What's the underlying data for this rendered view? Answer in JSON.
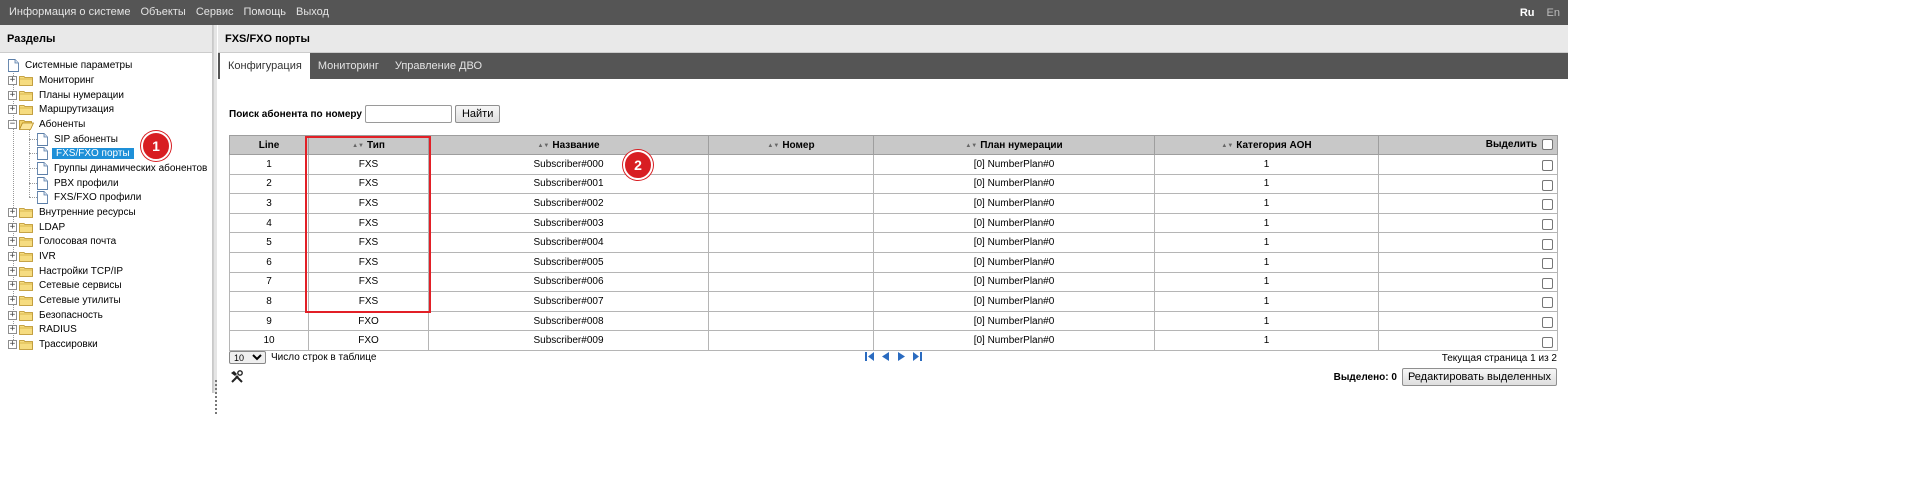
{
  "topbar": {
    "menu": [
      "Информация о системе",
      "Объекты",
      "Сервис",
      "Помощь",
      "Выход"
    ],
    "languages": [
      "Ru",
      "En"
    ],
    "active_language": "Ru"
  },
  "sidebar": {
    "title": "Разделы",
    "items": [
      {
        "label": "Системные параметры"
      },
      {
        "label": "Мониторинг"
      },
      {
        "label": "Планы нумерации"
      },
      {
        "label": "Маршрутизация"
      },
      {
        "label": "Абоненты"
      },
      {
        "label": "SIP абоненты"
      },
      {
        "label": "FXS/FXO порты"
      },
      {
        "label": "Группы динамических абонентов"
      },
      {
        "label": "PBX профили"
      },
      {
        "label": "FXS/FXO профили"
      },
      {
        "label": "Внутренние ресурсы"
      },
      {
        "label": "LDAP"
      },
      {
        "label": "Голосовая почта"
      },
      {
        "label": "IVR"
      },
      {
        "label": "Настройки TCP/IP"
      },
      {
        "label": "Сетевые сервисы"
      },
      {
        "label": "Сетевые утилиты"
      },
      {
        "label": "Безопасность"
      },
      {
        "label": "RADIUS"
      },
      {
        "label": "Трассировки"
      }
    ],
    "selected": "FXS/FXO порты"
  },
  "main": {
    "title": "FXS/FXO порты",
    "tabs": [
      "Конфигурация",
      "Мониторинг",
      "Управление ДВО"
    ],
    "active_tab": "Конфигурация",
    "search": {
      "label": "Поиск абонента по номеру",
      "value": "",
      "button": "Найти"
    },
    "table": {
      "columns": [
        "Line",
        "Тип",
        "Название",
        "Номер",
        "План нумерации",
        "Категория АОН",
        "Выделить"
      ],
      "rows": [
        {
          "line": "1",
          "type": "FXS",
          "name": "Subscriber#000",
          "number": "",
          "plan": "[0] NumberPlan#0",
          "category": "1"
        },
        {
          "line": "2",
          "type": "FXS",
          "name": "Subscriber#001",
          "number": "",
          "plan": "[0] NumberPlan#0",
          "category": "1"
        },
        {
          "line": "3",
          "type": "FXS",
          "name": "Subscriber#002",
          "number": "",
          "plan": "[0] NumberPlan#0",
          "category": "1"
        },
        {
          "line": "4",
          "type": "FXS",
          "name": "Subscriber#003",
          "number": "",
          "plan": "[0] NumberPlan#0",
          "category": "1"
        },
        {
          "line": "5",
          "type": "FXS",
          "name": "Subscriber#004",
          "number": "",
          "plan": "[0] NumberPlan#0",
          "category": "1"
        },
        {
          "line": "6",
          "type": "FXS",
          "name": "Subscriber#005",
          "number": "",
          "plan": "[0] NumberPlan#0",
          "category": "1"
        },
        {
          "line": "7",
          "type": "FXS",
          "name": "Subscriber#006",
          "number": "",
          "plan": "[0] NumberPlan#0",
          "category": "1"
        },
        {
          "line": "8",
          "type": "FXS",
          "name": "Subscriber#007",
          "number": "",
          "plan": "[0] NumberPlan#0",
          "category": "1"
        },
        {
          "line": "9",
          "type": "FXO",
          "name": "Subscriber#008",
          "number": "",
          "plan": "[0] NumberPlan#0",
          "category": "1"
        },
        {
          "line": "10",
          "type": "FXO",
          "name": "Subscriber#009",
          "number": "",
          "plan": "[0] NumberPlan#0",
          "category": "1"
        }
      ]
    },
    "footer": {
      "rows_per_page": "10",
      "rows_label": "Число строк в таблице",
      "page_info": "Текущая страница 1 из 2",
      "selected_label": "Выделено: 0",
      "edit_selected_button": "Редактировать выделенных"
    }
  },
  "annotations": {
    "badge_1": "1",
    "badge_2": "2"
  },
  "colors": {
    "menu_bar": "#555555",
    "selection": "#1e90d8",
    "annotation_red": "#e21f26",
    "header_gray": "#c8c8c8"
  }
}
